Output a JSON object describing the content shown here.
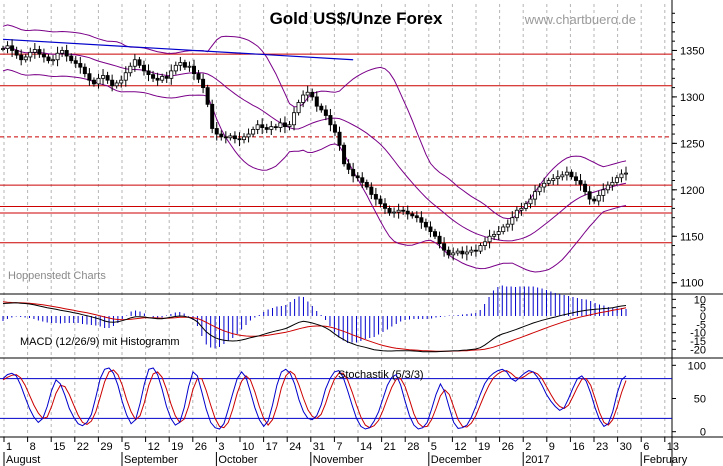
{
  "chart_data": {
    "type": "candlestick",
    "title": "Gold US$/Unze Forex",
    "watermark": "www.chartbuero.de",
    "source_label": "Hoppenstedt Charts",
    "colors": {
      "grid": "#b5b5b5",
      "red": "#cc0000",
      "blue": "#0000cc",
      "purple": "#7a0088",
      "black": "#000000"
    },
    "price_axis": {
      "ticks": [
        1100,
        1150,
        1200,
        1250,
        1300,
        1350
      ],
      "range": [
        1090,
        1400
      ]
    },
    "horizontal_levels": [
      {
        "value": 1346,
        "style": "solid"
      },
      {
        "value": 1312,
        "style": "solid"
      },
      {
        "value": 1257,
        "style": "dashed"
      },
      {
        "value": 1205,
        "style": "solid"
      },
      {
        "value": 1182,
        "style": "solid"
      },
      {
        "value": 1175,
        "style": "solid"
      },
      {
        "value": 1143,
        "style": "solid"
      }
    ],
    "trendline": {
      "from": [
        0,
        1362
      ],
      "to": [
        77,
        1340
      ]
    },
    "x_axis": {
      "day_labels": [
        "1",
        "8",
        "15",
        "22",
        "29",
        "5",
        "12",
        "19",
        "26",
        "3",
        "10",
        "17",
        "24",
        "31",
        "7",
        "14",
        "21",
        "28",
        "5",
        "12",
        "19",
        "26",
        "2",
        "9",
        "16",
        "23",
        "30",
        "6",
        "13"
      ],
      "month_labels": [
        "August",
        "September",
        "October",
        "November",
        "December",
        "2017",
        "February"
      ],
      "month_start_index": [
        0,
        5,
        9,
        13,
        18,
        22,
        27
      ]
    },
    "price": [
      1352,
      1355,
      1350,
      1345,
      1340,
      1343,
      1348,
      1351,
      1346,
      1343,
      1339,
      1340,
      1347,
      1350,
      1344,
      1339,
      1336,
      1332,
      1325,
      1318,
      1314,
      1320,
      1323,
      1318,
      1312,
      1315,
      1318,
      1326,
      1333,
      1340,
      1334,
      1328,
      1324,
      1320,
      1318,
      1322,
      1320,
      1328,
      1334,
      1337,
      1332,
      1333,
      1325,
      1319,
      1310,
      1292,
      1266,
      1260,
      1257,
      1256,
      1258,
      1255,
      1254,
      1257,
      1260,
      1265,
      1270,
      1267,
      1265,
      1268,
      1267,
      1272,
      1268,
      1270,
      1283,
      1294,
      1302,
      1305,
      1300,
      1290,
      1286,
      1280,
      1270,
      1262,
      1248,
      1228,
      1222,
      1215,
      1213,
      1208,
      1203,
      1195,
      1190,
      1185,
      1180,
      1175,
      1176,
      1178,
      1177,
      1174,
      1172,
      1170,
      1165,
      1160,
      1155,
      1150,
      1142,
      1135,
      1130,
      1132,
      1134,
      1131,
      1133,
      1135,
      1134,
      1140,
      1144,
      1150,
      1152,
      1155,
      1160,
      1163,
      1170,
      1178,
      1180,
      1185,
      1190,
      1198,
      1203,
      1207,
      1210,
      1212,
      1214,
      1216,
      1219,
      1214,
      1210,
      1206,
      1198,
      1190,
      1188,
      1194,
      1200,
      1205,
      1208,
      1213,
      1217,
      1218
    ],
    "macd": {
      "axis_ticks": [
        10,
        5,
        0,
        -5,
        -10,
        -15,
        -20
      ],
      "range": [
        -24,
        12
      ],
      "macd_line": [
        7.5,
        7.7,
        7.8,
        7.9,
        7.7,
        7.5,
        7.2,
        6.8,
        6.2,
        5.6,
        5.0,
        4.5,
        4.0,
        3.4,
        3.0,
        2.5,
        2.0,
        1.5,
        0.8,
        0.2,
        -0.5,
        -1.2,
        -2.0,
        -3.0,
        -3.6,
        -3.8,
        -3.5,
        -2.8,
        -2.0,
        -1.0,
        -0.5,
        -0.4,
        -0.6,
        -1.0,
        -1.4,
        -1.6,
        -1.6,
        -1.2,
        -0.8,
        -0.3,
        0.0,
        -0.2,
        -0.8,
        -1.8,
        -3.5,
        -6.5,
        -9.5,
        -11.5,
        -13.0,
        -14.0,
        -14.5,
        -14.8,
        -15.0,
        -14.8,
        -14.4,
        -13.8,
        -13.0,
        -12.4,
        -11.8,
        -11.0,
        -10.2,
        -9.5,
        -8.8,
        -8.2,
        -7.5,
        -6.3,
        -5.0,
        -3.8,
        -3.2,
        -3.6,
        -4.2,
        -5.0,
        -5.8,
        -7.0,
        -8.6,
        -10.6,
        -12.5,
        -14.0,
        -15.5,
        -16.5,
        -17.5,
        -18.2,
        -18.8,
        -19.5,
        -20.2,
        -20.6,
        -20.9,
        -21.0,
        -21.0,
        -20.9,
        -20.8,
        -20.8,
        -20.9,
        -21.0,
        -21.2,
        -21.4,
        -21.5,
        -21.5,
        -21.4,
        -21.3,
        -21.2,
        -21.0,
        -20.9,
        -20.8,
        -20.6,
        -20.4,
        -20.1,
        -19.8,
        -19.0,
        -17.5,
        -15.6,
        -13.6,
        -12.0,
        -10.8,
        -10.0,
        -9.1,
        -8.2,
        -7.2,
        -6.2,
        -5.2,
        -4.2,
        -3.4,
        -2.6,
        -1.9,
        -1.2,
        -0.6,
        0.1,
        0.8,
        1.4,
        2.0,
        2.5,
        3.0,
        3.5,
        3.8,
        4.0,
        4.2,
        4.5,
        4.7,
        5.0,
        5.6,
        6.0,
        6.3
      ],
      "signal_line": [
        8.5,
        8.3,
        8.1,
        8.0,
        7.9,
        7.8,
        7.6,
        7.4,
        7.1,
        6.7,
        6.3,
        5.9,
        5.4,
        4.9,
        4.4,
        3.9,
        3.4,
        2.9,
        2.4,
        1.9,
        1.3,
        0.7,
        0.1,
        -0.6,
        -1.2,
        -1.8,
        -2.1,
        -2.2,
        -2.1,
        -1.9,
        -1.6,
        -1.3,
        -1.1,
        -1.0,
        -1.1,
        -1.2,
        -1.3,
        -1.3,
        -1.2,
        -1.0,
        -0.8,
        -0.7,
        -0.7,
        -1.0,
        -1.5,
        -2.5,
        -3.8,
        -5.2,
        -6.5,
        -7.8,
        -8.9,
        -9.8,
        -10.6,
        -11.2,
        -11.7,
        -12.0,
        -12.1,
        -12.1,
        -12.0,
        -11.8,
        -11.5,
        -11.1,
        -10.7,
        -10.2,
        -9.7,
        -9.1,
        -8.4,
        -7.7,
        -7.0,
        -6.5,
        -6.2,
        -6.0,
        -6.0,
        -6.2,
        -6.6,
        -7.3,
        -8.2,
        -9.1,
        -10.1,
        -11.2,
        -12.2,
        -13.2,
        -14.2,
        -15.1,
        -16.0,
        -16.9,
        -17.7,
        -18.3,
        -18.9,
        -19.3,
        -19.7,
        -20.0,
        -20.2,
        -20.4,
        -20.6,
        -20.8,
        -20.9,
        -21.0,
        -21.1,
        -21.1,
        -21.1,
        -21.1,
        -21.0,
        -21.0,
        -20.9,
        -20.8,
        -20.6,
        -20.4,
        -20.2,
        -19.9,
        -19.4,
        -18.7,
        -17.8,
        -16.9,
        -15.9,
        -15.0,
        -14.0,
        -13.1,
        -12.1,
        -11.1,
        -10.1,
        -9.1,
        -8.1,
        -7.1,
        -6.1,
        -5.2,
        -4.3,
        -3.4,
        -2.6,
        -1.8,
        -1.1,
        -0.4,
        0.2,
        0.8,
        1.4,
        1.9,
        2.4,
        2.9,
        3.4,
        3.9,
        4.4,
        4.9
      ]
    },
    "stochastic": {
      "label": "Stochastik (5/3/3)",
      "axis_ticks": [
        100,
        50,
        0
      ],
      "levels": [
        80,
        20
      ],
      "range": [
        -8,
        108
      ],
      "k_line": [
        80,
        86,
        88,
        84,
        70,
        52,
        35,
        22,
        14,
        20,
        38,
        62,
        78,
        72,
        55,
        35,
        22,
        12,
        9,
        14,
        26,
        52,
        80,
        94,
        96,
        88,
        70,
        45,
        25,
        12,
        18,
        42,
        72,
        94,
        96,
        86,
        64,
        38,
        20,
        10,
        14,
        36,
        68,
        90,
        84,
        60,
        34,
        14,
        6,
        4,
        12,
        34,
        58,
        80,
        90,
        82,
        60,
        36,
        18,
        8,
        16,
        40,
        70,
        90,
        94,
        88,
        72,
        48,
        30,
        20,
        18,
        24,
        40,
        64,
        80,
        90,
        92,
        82,
        62,
        40,
        20,
        8,
        4,
        6,
        16,
        30,
        50,
        70,
        82,
        86,
        70,
        46,
        24,
        10,
        4,
        6,
        14,
        34,
        56,
        72,
        60,
        36,
        14,
        5,
        6,
        10,
        22,
        38,
        56,
        72,
        82,
        88,
        92,
        94,
        90,
        80,
        76,
        82,
        88,
        92,
        90,
        82,
        70,
        56,
        46,
        38,
        32,
        36,
        50,
        66,
        80,
        84,
        76,
        58,
        36,
        18,
        8,
        12,
        30,
        58,
        78,
        84
      ],
      "d_line": [
        78,
        82,
        85,
        86,
        81,
        70,
        55,
        40,
        28,
        20,
        22,
        38,
        58,
        70,
        68,
        56,
        40,
        25,
        14,
        11,
        16,
        30,
        52,
        75,
        90,
        93,
        86,
        70,
        48,
        30,
        18,
        24,
        44,
        70,
        87,
        90,
        82,
        64,
        42,
        24,
        14,
        19,
        38,
        64,
        80,
        80,
        62,
        40,
        20,
        8,
        6,
        14,
        34,
        58,
        76,
        84,
        78,
        60,
        38,
        20,
        10,
        18,
        38,
        66,
        84,
        91,
        86,
        70,
        50,
        33,
        23,
        20,
        26,
        42,
        63,
        79,
        88,
        88,
        78,
        60,
        40,
        22,
        10,
        6,
        9,
        17,
        32,
        50,
        67,
        79,
        80,
        68,
        48,
        27,
        13,
        7,
        8,
        18,
        35,
        54,
        63,
        56,
        37,
        18,
        8,
        7,
        13,
        24,
        40,
        56,
        70,
        81,
        87,
        91,
        92,
        88,
        82,
        80,
        83,
        88,
        90,
        87,
        80,
        68,
        56,
        45,
        38,
        35,
        40,
        53,
        67,
        79,
        80,
        70,
        50,
        29,
        14,
        10,
        18,
        37,
        59,
        77
      ]
    }
  }
}
